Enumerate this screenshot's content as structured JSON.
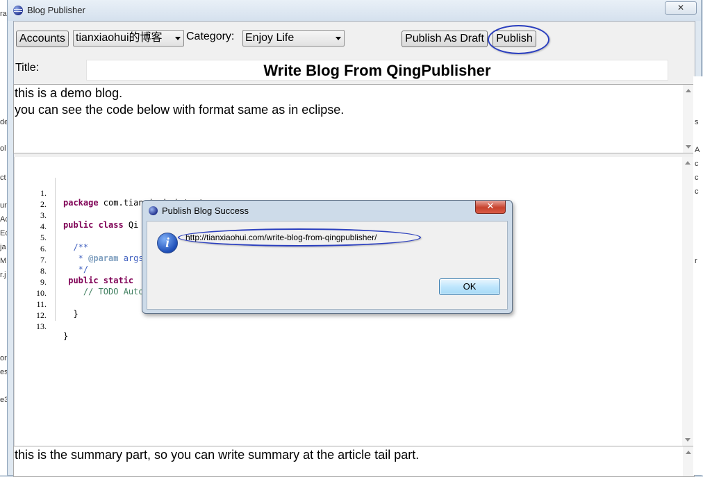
{
  "window": {
    "title": "Blog Publisher",
    "close_glyph": "✕"
  },
  "toolbar": {
    "accounts_label": "Accounts",
    "account_selected": "tianxiaohui的博客",
    "category_label": "Category:",
    "category_selected": "Enjoy Life",
    "publish_draft_label": "Publish As Draft",
    "publish_label": "Publish"
  },
  "title_row": {
    "label": "Title:",
    "value": "Write Blog From QingPublisher"
  },
  "intro": {
    "lines": [
      "this is a demo blog.",
      "you can see the code below with format same as in eclipse."
    ]
  },
  "code": {
    "line_numbers": [
      "1.",
      "2.",
      "3.",
      "4.",
      "5.",
      "6.",
      "7.",
      "8.",
      "9.",
      "10.",
      "11.",
      "12.",
      "13."
    ],
    "l1_kw": "package",
    "l1_rest": " com.tianxiaohui.test;",
    "l3_kw": "public class",
    "l3_rest": " Qi",
    "l5": "  /**",
    "l6_pre": "   * ",
    "l6_anno": "@param",
    "l6_rest": " args",
    "l7": "   */",
    "l8_kw": " public static",
    "l9": "    // TODO Auto",
    "l11": "  }",
    "l13": "}"
  },
  "summary": {
    "text": "this is the summary part, so you can write summary at the article tail part."
  },
  "dialog": {
    "title": "Publish Blog Success",
    "close_glyph": "✕",
    "message": "http://tianxiaohui.com/write-blog-from-qingpublisher/",
    "ok_label": "OK"
  },
  "background_fragments": {
    "left": [
      "ra",
      "de",
      "ol",
      "ct",
      "ur",
      "Ac",
      "Ec",
      "ja",
      "M",
      "r.j",
      "or",
      "es",
      "e3"
    ],
    "right": [
      "s",
      "A",
      "c",
      "c",
      "c",
      "r"
    ]
  }
}
